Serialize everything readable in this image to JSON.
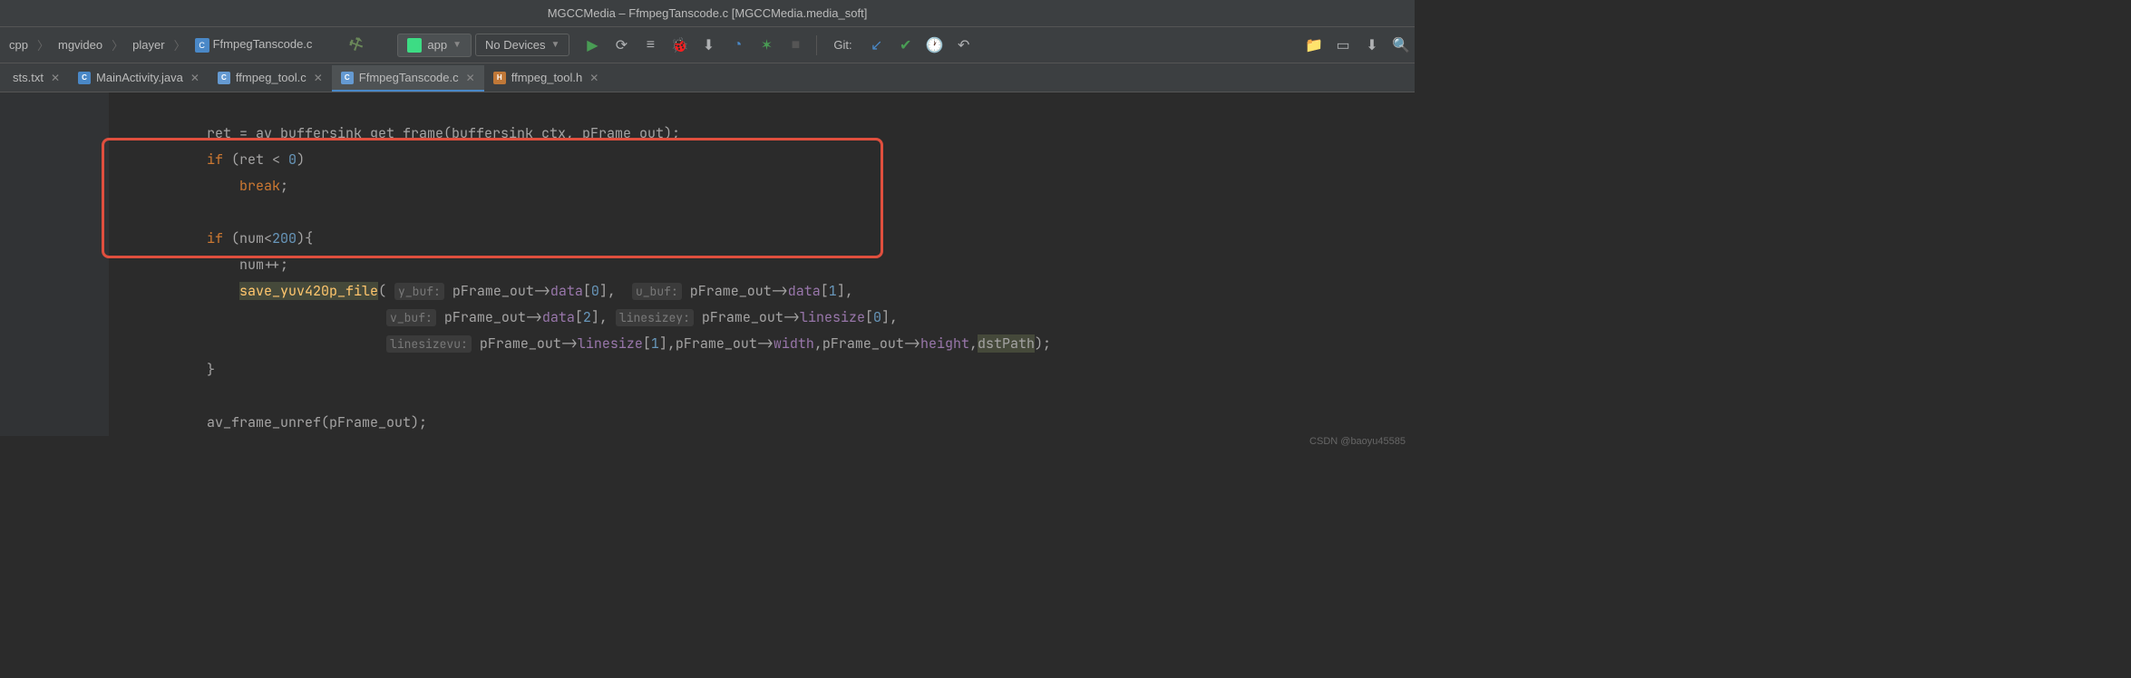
{
  "window": {
    "title_project": "MGCCMedia",
    "title_file": "FfmpegTanscode.c",
    "title_module": "MGCCMedia.media_soft"
  },
  "breadcrumb": [
    "cpp",
    "mgvideo",
    "player",
    "FfmpegTanscode.c"
  ],
  "config": {
    "name": "app"
  },
  "device": {
    "label": "No Devices"
  },
  "git_label": "Git:",
  "tabs": [
    {
      "label": "sts.txt",
      "type": "txt",
      "active": false
    },
    {
      "label": "MainActivity.java",
      "type": "java",
      "active": false
    },
    {
      "label": "ffmpeg_tool.c",
      "type": "c",
      "active": false
    },
    {
      "label": "FfmpegTanscode.c",
      "type": "c",
      "active": true
    },
    {
      "label": "ffmpeg_tool.h",
      "type": "h",
      "active": false
    }
  ],
  "code": {
    "l1_a": "            ret = av_buffersink_get_frame(buffersink_ctx, pFrame_out);",
    "l2_if": "if",
    "l2_rest": " (ret < ",
    "l2_zero": "0",
    "l2_end": ")",
    "l3_break": "break",
    "l3_semi": ";",
    "l5_if": "if",
    "l5_a": " (num<",
    "l5_num": "200",
    "l5_b": "){",
    "l6": "                num++;",
    "l7_fn": "save_yuv420p_file",
    "l7_open": "( ",
    "l7_h1": "y_buf:",
    "l7_p1a": " pFrame_out->",
    "l7_p1b": "data",
    "l7_p1c": "[",
    "l7_p1d": "0",
    "l7_p1e": "],  ",
    "l7_h2": "u_buf:",
    "l7_p2a": " pFrame_out->",
    "l7_p2b": "data",
    "l7_p2c": "[",
    "l7_p2d": "1",
    "l7_p2e": "],",
    "l8_h1": "v_buf:",
    "l8_p1a": " pFrame_out->",
    "l8_p1b": "data",
    "l8_p1c": "[",
    "l8_p1d": "2",
    "l8_p1e": "], ",
    "l8_h2": "linesizey:",
    "l8_p2a": " pFrame_out->",
    "l8_p2b": "linesize",
    "l8_p2c": "[",
    "l8_p2d": "0",
    "l8_p2e": "],",
    "l9_h1": "linesizevu:",
    "l9_p1a": " pFrame_out->",
    "l9_p1b": "linesize",
    "l9_p1c": "[",
    "l9_p1d": "1",
    "l9_p1e": "],pFrame_out->",
    "l9_w": "width",
    "l9_c": ",pFrame_out->",
    "l9_ht": "height",
    "l9_c2": ",",
    "l9_dst": "dstPath",
    "l9_end": ");",
    "l10": "            }",
    "l12": "            av_frame_unref(pFrame_out);"
  },
  "watermark": "CSDN @baoyu45585"
}
